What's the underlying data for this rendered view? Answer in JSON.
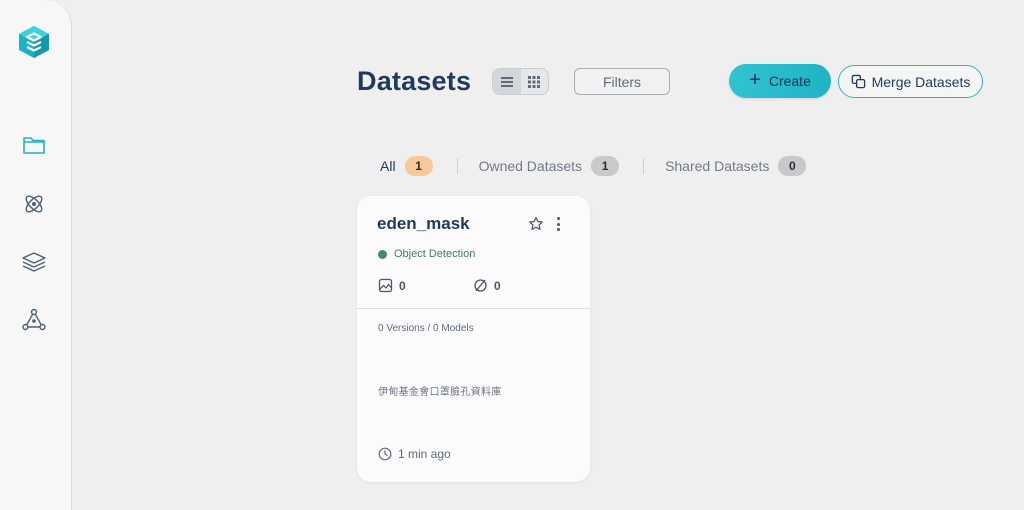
{
  "page": {
    "title": "Datasets"
  },
  "sidebar": {
    "logo": "datature-logo",
    "items": [
      {
        "icon": "folder-icon"
      },
      {
        "icon": "atom-icon"
      },
      {
        "icon": "layers-icon"
      },
      {
        "icon": "network-icon"
      }
    ]
  },
  "toolbar": {
    "filters_label": "Filters",
    "create_label": "Create",
    "merge_label": "Merge Datasets"
  },
  "tabs": [
    {
      "label": "All",
      "count": "1",
      "active": true
    },
    {
      "label": "Owned Datasets",
      "count": "1",
      "active": false
    },
    {
      "label": "Shared Datasets",
      "count": "0",
      "active": false
    }
  ],
  "cards": [
    {
      "title": "eden_mask",
      "type": "Object Detection",
      "images_count": "0",
      "annotations_count": "0",
      "versions_models": "0 Versions / 0 Models",
      "description": "伊甸基金會口罩臉孔資料庫",
      "updated": "1 min ago"
    }
  ],
  "colors": {
    "accent": "#2fc3d3",
    "title": "#1f3a5f",
    "object_detection": "#4a8a63",
    "badge_active": "#f5c998",
    "badge_default": "#c9c9c9"
  }
}
